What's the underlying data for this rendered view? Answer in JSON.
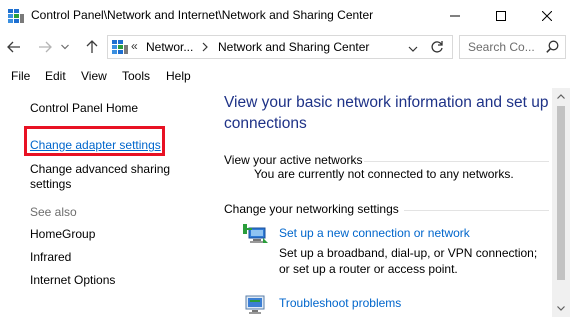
{
  "window": {
    "title": "Control Panel\\Network and Internet\\Network and Sharing Center"
  },
  "address": {
    "overflow_marker": "«",
    "crumb_parent": "Networ...",
    "crumb_current": "Network and Sharing Center"
  },
  "search": {
    "placeholder": "Search Co..."
  },
  "menu": {
    "file": "File",
    "edit": "Edit",
    "view": "View",
    "tools": "Tools",
    "help": "Help"
  },
  "sidebar": {
    "home": "Control Panel Home",
    "change_adapter": "Change adapter settings",
    "change_sharing_line1": "Change advanced sharing",
    "change_sharing_line2": "settings",
    "see_also": "See also",
    "homegroup": "HomeGroup",
    "infrared": "Infrared",
    "internet_options": "Internet Options"
  },
  "main": {
    "title": "View your basic network information and set up connections",
    "active_networks_label": "View your active networks",
    "no_networks_text": "You are currently not connected to any networks.",
    "change_settings_label": "Change your networking settings",
    "setup_link": "Set up a new connection or network",
    "setup_desc": "Set up a broadband, dial-up, or VPN connection; or set up a router or access point.",
    "troubleshoot_link": "Troubleshoot problems"
  },
  "colors": {
    "link": "#0066cc",
    "title": "#1e3287",
    "highlight_border": "#e81123"
  },
  "icons": {
    "app": "network-sharing-center-icon",
    "back": "back-arrow-icon",
    "forward": "forward-arrow-icon",
    "history": "chevron-down-icon",
    "up": "up-arrow-icon",
    "refresh": "refresh-icon",
    "search": "search-icon",
    "setup": "setup-connection-icon",
    "troubleshoot": "troubleshoot-icon"
  }
}
